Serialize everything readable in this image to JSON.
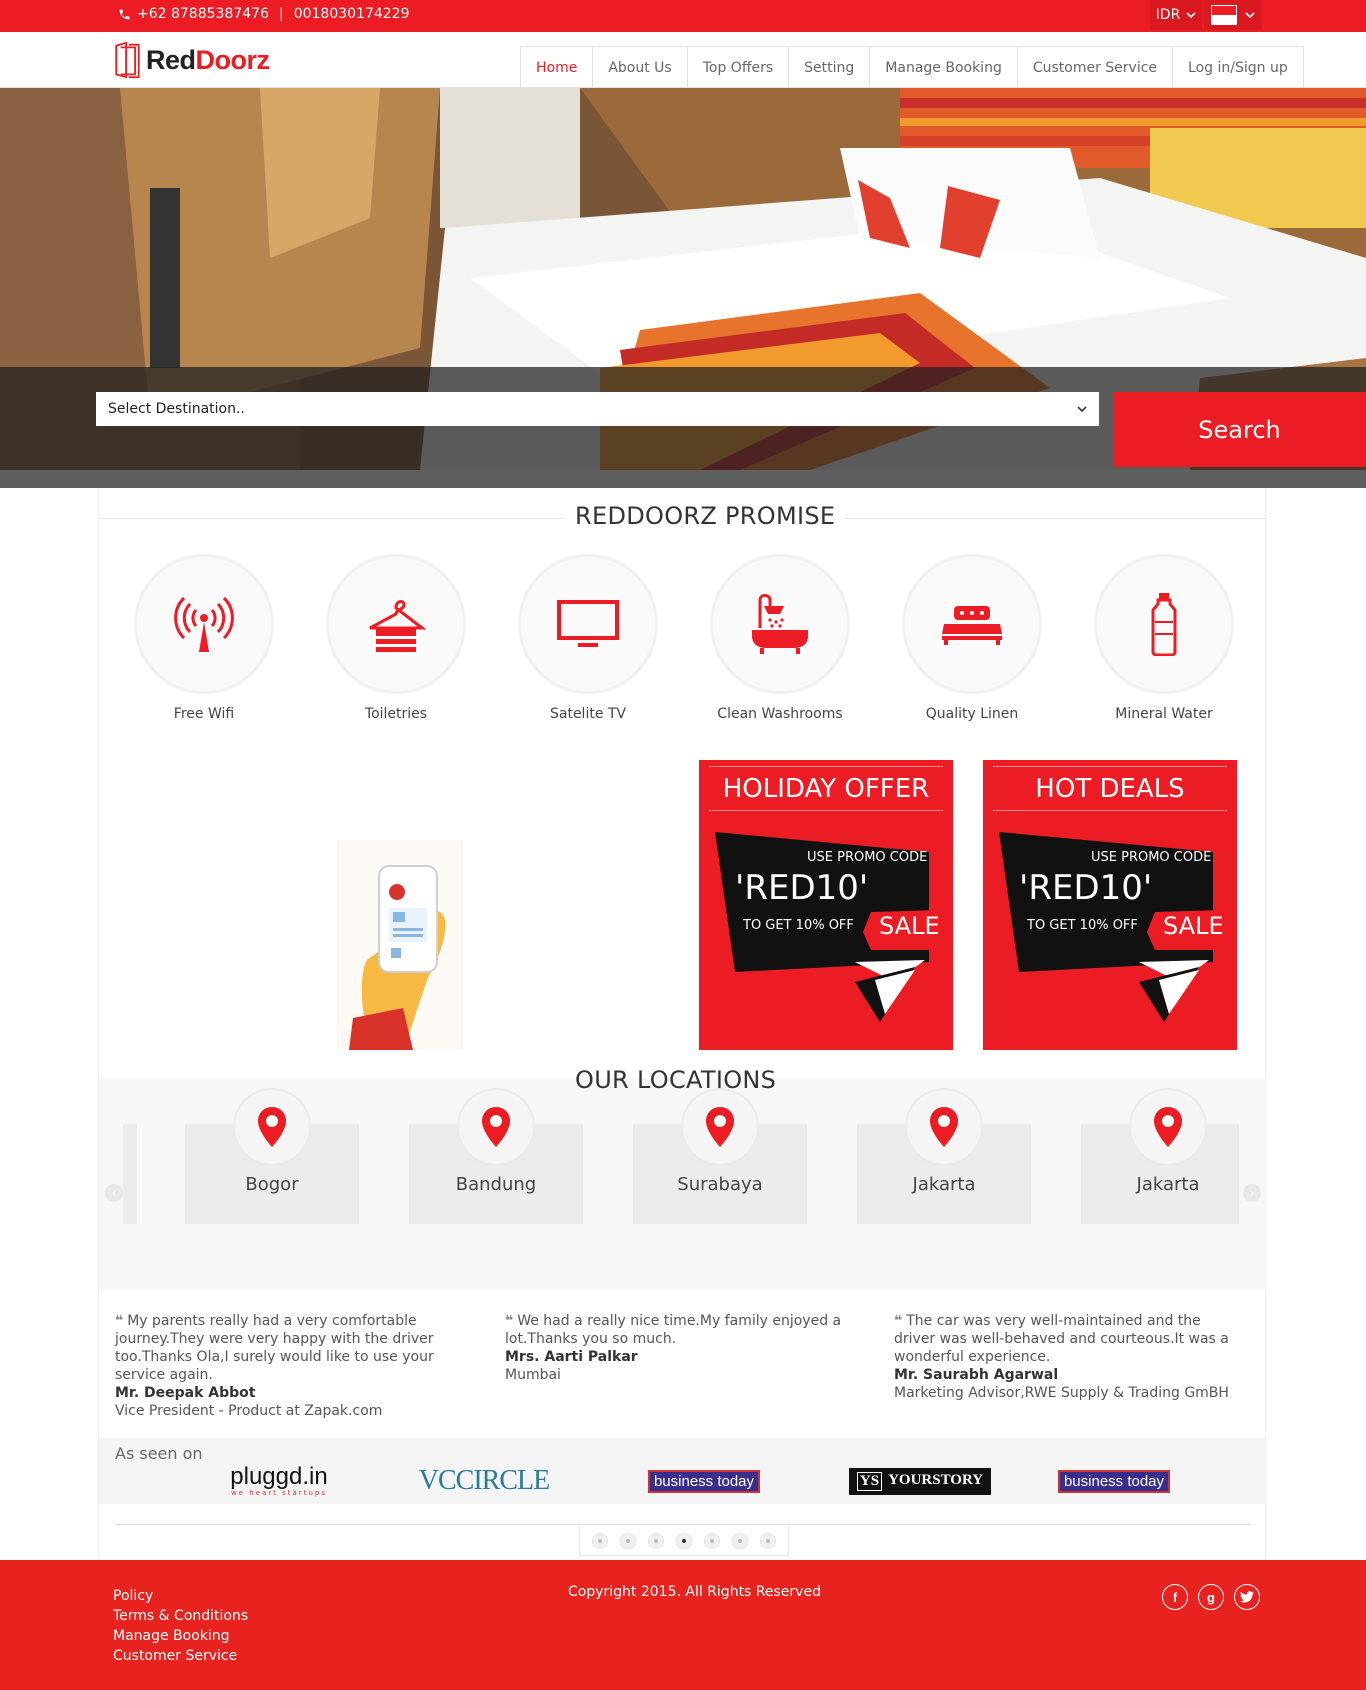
{
  "topbar": {
    "phone": "+62 87885387476",
    "separator": "|",
    "phone2": "0018030174229",
    "currency": "IDR"
  },
  "header": {
    "logo_part1": "Red",
    "logo_part2": "Doorz",
    "nav": [
      "Home",
      "About Us",
      "Top Offers",
      "Setting",
      "Manage Booking",
      "Customer Service",
      "Log in/Sign up"
    ]
  },
  "search": {
    "placeholder": "Select Destination..",
    "button": "Search"
  },
  "promise": {
    "title": "REDDOORZ PROMISE",
    "items": [
      "Free Wifi",
      "Toiletries",
      "Satelite TV",
      "Clean Washrooms",
      "Quality Linen",
      "Mineral Water"
    ]
  },
  "offers": [
    {
      "title": "HOLIDAY OFFER",
      "promo_label": "USE PROMO CODE",
      "code": "'RED10'",
      "subtitle": "TO GET 10% OFF",
      "sale": "SALE"
    },
    {
      "title": "HOT DEALS",
      "promo_label": "USE PROMO CODE",
      "code": "'RED10'",
      "subtitle": "TO GET 10% OFF",
      "sale": "SALE"
    }
  ],
  "locations": {
    "title": "OUR LOCATIONS",
    "items": [
      "Bogor",
      "Bandung",
      "Surabaya",
      "Jakarta",
      "Jakarta"
    ]
  },
  "testimonials": [
    {
      "text": "My parents really had a very comfortable journey.They were very happy with the driver too.Thanks Ola,I surely would like to use your service again.",
      "name": "Mr. Deepak Abbot",
      "role": "Vice President - Product at Zapak.com"
    },
    {
      "text": "We had a really nice time.My family enjoyed a lot.Thanks you so much.",
      "name": "Mrs. Aarti Palkar",
      "role": "Mumbai"
    },
    {
      "text": "The car was very well-maintained and the driver was well-behaved and courteous.It was a wonderful experience.",
      "name": "Mr. Saurabh Agarwal",
      "role": "Marketing Advisor,RWE Supply & Trading GmBH"
    }
  ],
  "seen_on": {
    "title": "As seen on",
    "logos": [
      "pluggd.in",
      "VCCIRCLE",
      "business today",
      "YOURSTORY",
      "business today"
    ],
    "pluggd_tagline": "we heart startups"
  },
  "pagination": {
    "count": 7,
    "active": 4
  },
  "footer": {
    "links": [
      "Policy",
      "Terms & Conditions",
      "Manage Booking",
      "Customer Service"
    ],
    "copyright": "Copyright 2015. All Rights Reserved",
    "social": [
      "f",
      "g",
      "t"
    ]
  },
  "colors": {
    "brand": "#ec1c24",
    "footer": "#e8231f"
  }
}
